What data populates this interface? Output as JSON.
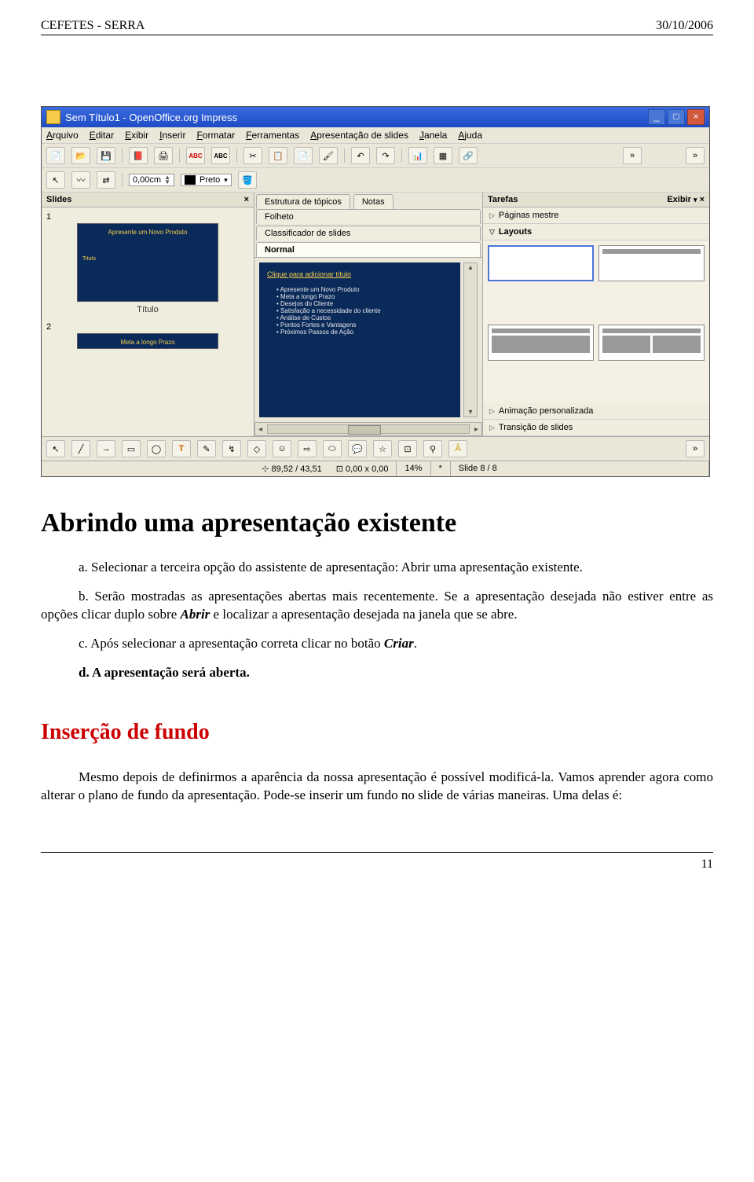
{
  "header": {
    "left": "CEFETES - SERRA",
    "right": "30/10/2006"
  },
  "window": {
    "title": "Sem Título1 - OpenOffice.org Impress",
    "menus": [
      "Arquivo",
      "Editar",
      "Exibir",
      "Inserir",
      "Formatar",
      "Ferramentas",
      "Apresentação de slides",
      "Janela",
      "Ajuda"
    ],
    "toolbar2": {
      "measure": "0,00cm",
      "colorname": "Preto"
    },
    "slides_panel": {
      "title": "Slides",
      "thumb1_title": "Apresente um Novo Produto",
      "thumb1_sub": "Titulo",
      "thumb1_caption": "Título",
      "thumb2_title": "Meta a longo Prazo"
    },
    "center_panel": {
      "tabs": [
        "Estrutura de tópicos",
        "Notas",
        "Folheto",
        "Classificador de slides",
        "Normal"
      ],
      "slide_title": "Clique para adicionar título",
      "bullets": [
        "Apresente um Novo Produto",
        "Meta a longo Prazo",
        "Desejos do Cliente",
        "Satisfação a necessidade do cliente",
        "Análise de Custos",
        "Pontos Fortes e Vantagens",
        "Próximos Passos de Ação"
      ]
    },
    "tasks_panel": {
      "title": "Tarefas",
      "view": "Exibir",
      "items": [
        "Páginas mestre",
        "Layouts",
        "Animação personalizada",
        "Transição de slides"
      ]
    },
    "status": {
      "pos": "89,52 / 43,51",
      "size": "0,00 x 0,00",
      "zoom": "14%",
      "star": "*",
      "slide": "Slide 8 / 8"
    }
  },
  "doc": {
    "h1": "Abrindo uma apresentação existente",
    "pa": "a. Selecionar a terceira opção do assistente de apresentação: Abrir uma apresentação existente.",
    "pb": "b. Serão mostradas as apresentações abertas mais recentemente. Se a apresentação desejada não estiver entre as opções clicar duplo sobre ",
    "pb_bold": "Abrir",
    "pb_tail": " e localizar a apresentação desejada na janela que se abre.",
    "pc": "c. Após selecionar a apresentação correta clicar no botão ",
    "pc_bold": "Criar",
    "pc_tail": ".",
    "pd": "d. A apresentação será aberta.",
    "h2": "Inserção de fundo",
    "p2": "Mesmo depois de definirmos a aparência da nossa apresentação é possível modificá-la. Vamos aprender agora como alterar o plano de fundo da apresentação. Pode-se inserir um fundo   no slide de várias maneiras. Uma delas é:",
    "pagenum": "11"
  }
}
